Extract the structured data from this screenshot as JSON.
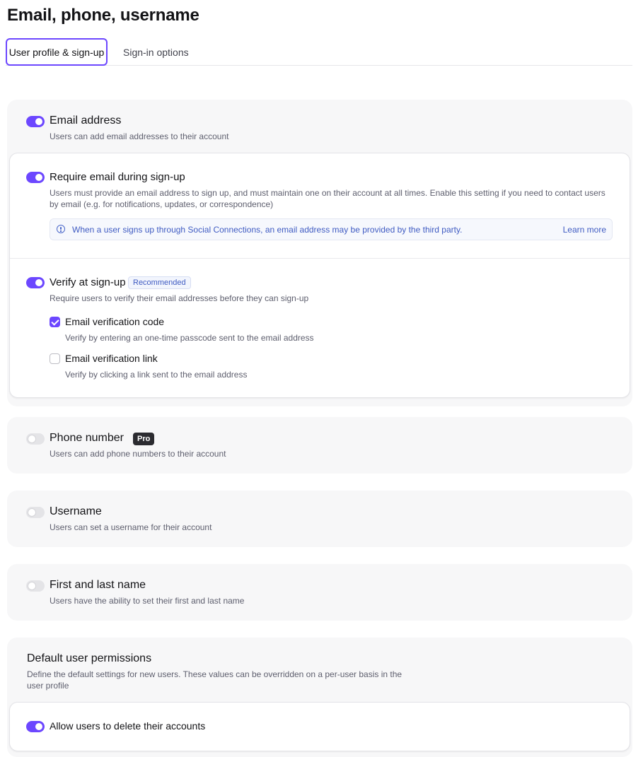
{
  "page": {
    "title": "Email, phone, username"
  },
  "tabs": [
    {
      "label": "User profile & sign-up",
      "active": true
    },
    {
      "label": "Sign-in options",
      "active": false
    }
  ],
  "email": {
    "toggle": "on",
    "title": "Email address",
    "description": "Users can add email addresses to their account",
    "require": {
      "toggle": "on",
      "title": "Require email during sign-up",
      "description": "Users must provide an email address to sign up, and must maintain one on their account at all times. Enable this setting if you need to contact users by email (e.g. for notifications, updates, or correspondence)",
      "info_text": "When a user signs up through Social Connections, an email address may be provided by the third party.",
      "learn_more": "Learn more"
    },
    "verify": {
      "toggle": "on",
      "title": "Verify at sign-up",
      "badge": "Recommended",
      "description": "Require users to verify their email addresses before they can sign-up",
      "options": [
        {
          "label": "Email verification code",
          "description": "Verify by entering an one-time passcode sent to the email address",
          "checked": true
        },
        {
          "label": "Email verification link",
          "description": "Verify by clicking a link sent to the email address",
          "checked": false
        }
      ]
    }
  },
  "phone": {
    "toggle": "off",
    "title": "Phone number",
    "badge": "Pro",
    "description": "Users can add phone numbers to their account"
  },
  "username": {
    "toggle": "off",
    "title": "Username",
    "description": "Users can set a username for their account"
  },
  "name": {
    "toggle": "off",
    "title": "First and last name",
    "description": "Users have the ability to set their first and last name"
  },
  "permissions": {
    "title": "Default user permissions",
    "description_line1": "Define the default settings for new users. These values can be overridden on a per-user basis in the",
    "description_line2": "user profile",
    "delete": {
      "toggle": "on",
      "label": "Allow users to delete their accounts"
    }
  },
  "colors": {
    "accent": "#6c47ff",
    "info": "#3f5bc2",
    "card_bg": "#f7f7f8"
  }
}
